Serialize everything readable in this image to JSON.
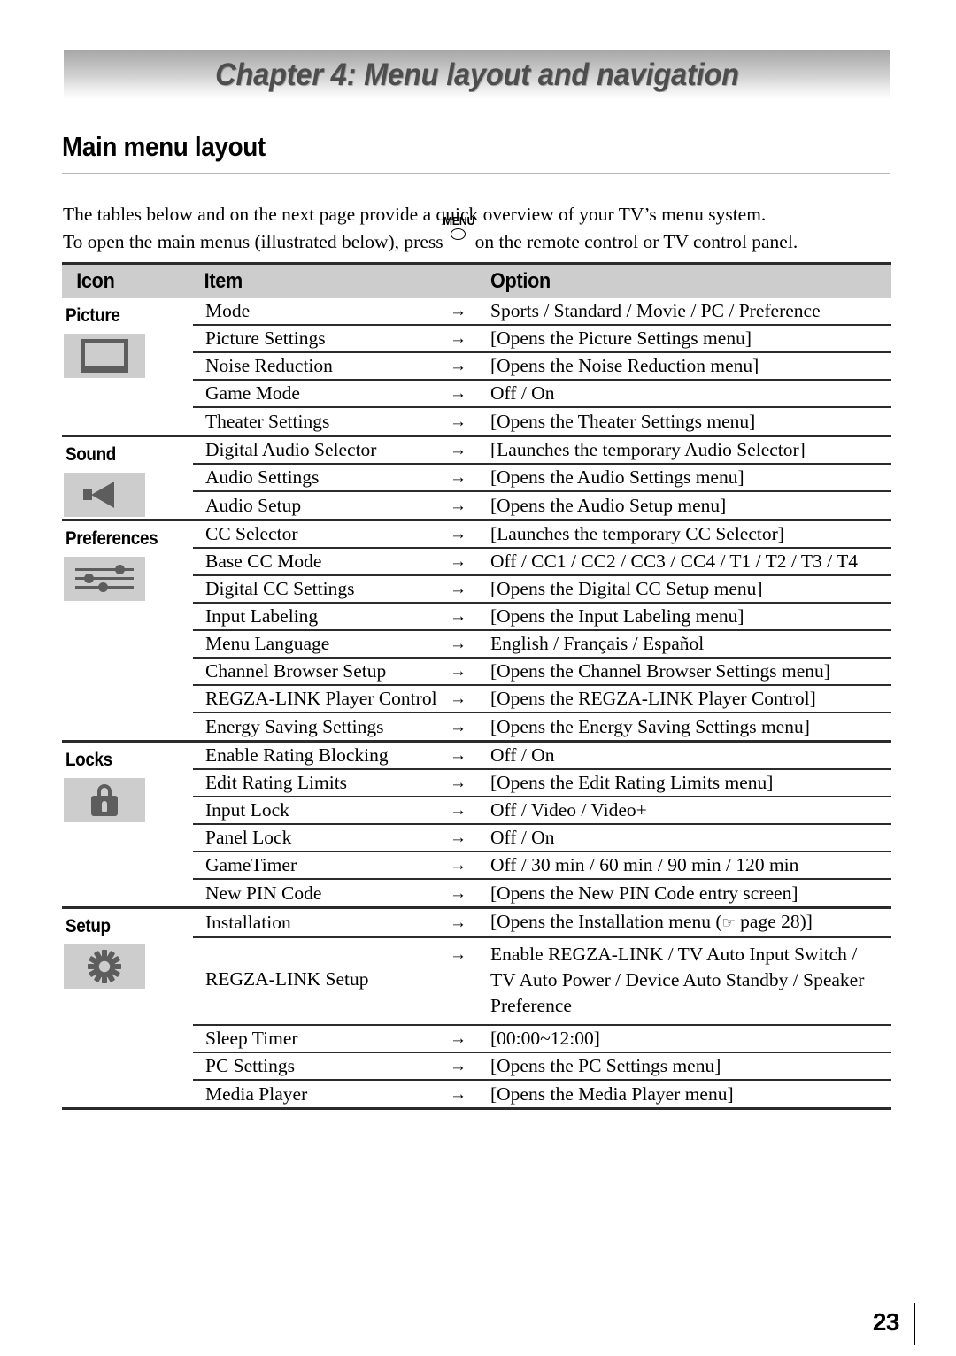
{
  "chapter": {
    "title": "Chapter 4: Menu layout and navigation"
  },
  "section": {
    "heading": "Main menu layout"
  },
  "intro": {
    "line1": "The tables below and on the next page provide a quick overview of your TV’s menu system.",
    "line2_before": "To open the main menus (illustrated below), press",
    "menu_button_label": "MENU",
    "line2_after": "on the remote control or TV control panel."
  },
  "table": {
    "headers": {
      "icon": "Icon",
      "item": "Item",
      "option": "Option"
    },
    "arrow": "→",
    "groups": [
      {
        "label": "Picture",
        "icon": "tv-icon",
        "rows": [
          {
            "item": "Mode",
            "option": "Sports / Standard / Movie / PC / Preference"
          },
          {
            "item": "Picture Settings",
            "option": "[Opens the Picture Settings menu]"
          },
          {
            "item": "Noise Reduction",
            "option": "[Opens the Noise Reduction menu]"
          },
          {
            "item": "Game Mode",
            "option": "Off / On"
          },
          {
            "item": "Theater Settings",
            "option": "[Opens the Theater Settings menu]"
          }
        ]
      },
      {
        "label": "Sound",
        "icon": "speaker-icon",
        "rows": [
          {
            "item": "Digital Audio Selector",
            "option": "[Launches the temporary Audio Selector]"
          },
          {
            "item": "Audio Settings",
            "option": "[Opens the Audio Settings menu]"
          },
          {
            "item": "Audio Setup",
            "option": "[Opens the Audio Setup menu]"
          }
        ]
      },
      {
        "label": "Preferences",
        "icon": "sliders-icon",
        "rows": [
          {
            "item": "CC Selector",
            "option": "[Launches the temporary CC Selector]"
          },
          {
            "item": "Base CC Mode",
            "option": "Off / CC1 / CC2 / CC3 / CC4 / T1 / T2 / T3 / T4"
          },
          {
            "item": "Digital CC Settings",
            "option": "[Opens the Digital CC Setup menu]"
          },
          {
            "item": "Input Labeling",
            "option": "[Opens the Input Labeling menu]"
          },
          {
            "item": "Menu Language",
            "option": "English / Français / Español"
          },
          {
            "item": "Channel Browser Setup",
            "option": "[Opens the Channel Browser Settings menu]"
          },
          {
            "item": "REGZA-LINK Player Control",
            "option": "[Opens the REGZA-LINK Player Control]"
          },
          {
            "item": "Energy Saving Settings",
            "option": "[Opens the Energy Saving Settings menu]"
          }
        ]
      },
      {
        "label": "Locks",
        "icon": "lock-icon",
        "rows": [
          {
            "item": "Enable Rating Blocking",
            "option": "Off / On"
          },
          {
            "item": "Edit Rating Limits",
            "option": "[Opens the Edit Rating Limits menu]"
          },
          {
            "item": "Input Lock",
            "option": "Off / Video / Video+"
          },
          {
            "item": "Panel Lock",
            "option": "Off / On"
          },
          {
            "item": "GameTimer",
            "option": "Off / 30 min / 60 min / 90 min / 120 min"
          },
          {
            "item": "New PIN Code",
            "option": "[Opens the New PIN Code entry screen]"
          }
        ]
      },
      {
        "label": "Setup",
        "icon": "gear-icon",
        "rows": [
          {
            "item": "Installation",
            "option_prefix": "[Opens the Installation menu (",
            "option_hand": "☞",
            "option_suffix": " page 28)]"
          },
          {
            "item": "REGZA-LINK Setup",
            "option": "Enable REGZA-LINK / TV Auto Input Switch / TV Auto Power / Device Auto Standby / Speaker Preference",
            "tall": true
          },
          {
            "item": "Sleep Timer",
            "option": "[00:00~12:00]"
          },
          {
            "item": "PC Settings",
            "option": "[Opens the PC Settings menu]"
          },
          {
            "item": "Media Player",
            "option": "[Opens the Media Player menu]"
          }
        ]
      }
    ]
  },
  "footer": {
    "page_number": "23"
  },
  "colors": {
    "header_band_top": "#a8a8a8",
    "table_header_bg": "#cdcdcd",
    "icon_tile_bg": "#cdcdcd",
    "icon_glyph": "#5d5d5d",
    "rule_dark": "#2b2b2b",
    "rule_light": "#b5b5b5",
    "chapter_text": "#4d4d4d"
  }
}
